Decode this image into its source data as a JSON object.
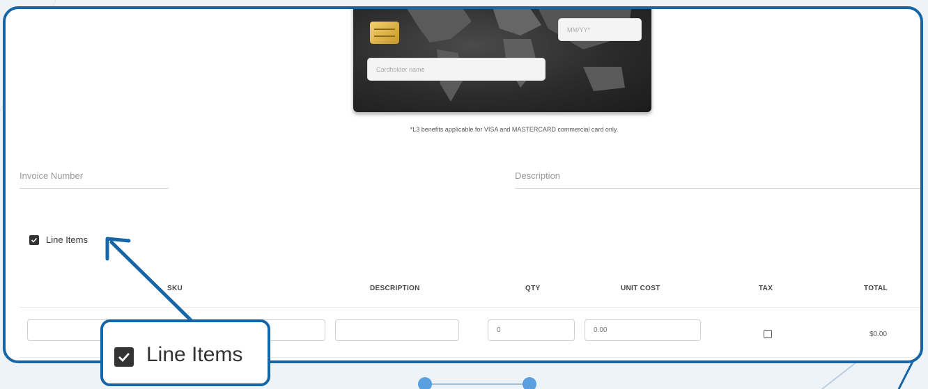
{
  "card": {
    "expiry_placeholder": "MM/YY*",
    "name_placeholder": "Cardholder name",
    "note": "*L3 benefits applicable for VISA and MASTERCARD commercial card only."
  },
  "fields": {
    "invoice_label": "Invoice Number",
    "description_label": "Description"
  },
  "line_items": {
    "label": "Line Items",
    "checked": true
  },
  "table": {
    "headers": {
      "sku": "SKU",
      "description": "DESCRIPTION",
      "qty": "QTY",
      "unit_cost": "UNIT COST",
      "tax": "TAX",
      "total": "TOTAL"
    },
    "row": {
      "sku": "",
      "description": "",
      "qty": "0",
      "unit_cost": "0.00",
      "tax_checked": false,
      "total": "$0.00"
    }
  },
  "callout": {
    "label": "Line Items"
  },
  "colors": {
    "accent": "#1565a7",
    "card": "#2b2b2b",
    "chip": "#e0b24a"
  }
}
